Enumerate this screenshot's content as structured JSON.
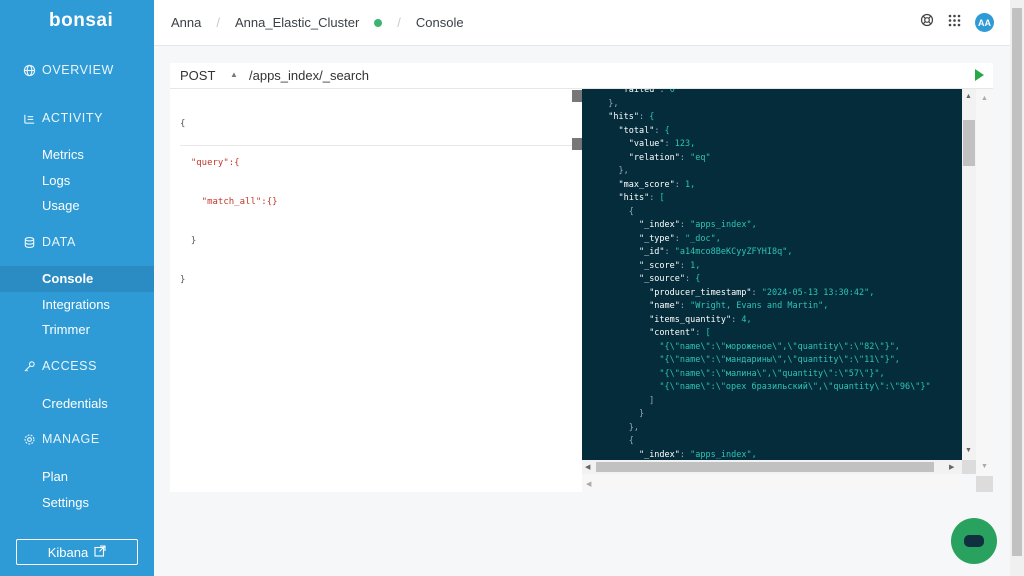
{
  "sidebar": {
    "logo": "bonsai",
    "sections": {
      "overview": "OVERVIEW",
      "activity": "ACTIVITY",
      "data": "DATA",
      "access": "ACCESS",
      "manage": "MANAGE"
    },
    "items": {
      "metrics": "Metrics",
      "logs": "Logs",
      "usage": "Usage",
      "console": "Console",
      "integrations": "Integrations",
      "trimmer": "Trimmer",
      "credentials": "Credentials",
      "plan": "Plan",
      "settings": "Settings"
    },
    "kibana": "Kibana"
  },
  "header": {
    "user": "Anna",
    "cluster": "Anna_Elastic_Cluster",
    "page": "Console",
    "avatar": "AA",
    "status_color": "#3cb371"
  },
  "console": {
    "method": "POST",
    "path": "/apps_index/_search",
    "request_lines": [
      "{",
      "  \"query\":{",
      "    \"match_all\":{}",
      "  }",
      "}"
    ],
    "response_lines": [
      "    \"failed\": 0",
      "  },",
      "  \"hits\": {",
      "    \"total\": {",
      "      \"value\": 123,",
      "      \"relation\": \"eq\"",
      "    },",
      "    \"max_score\": 1,",
      "    \"hits\": [",
      "      {",
      "        \"_index\": \"apps_index\",",
      "        \"_type\": \"_doc\",",
      "        \"_id\": \"a14mco8BeKCyyZFYHI8q\",",
      "        \"_score\": 1,",
      "        \"_source\": {",
      "          \"producer_timestamp\": \"2024-05-13 13:30:42\",",
      "          \"name\": \"Wright, Evans and Martin\",",
      "          \"items_quantity\": 4,",
      "          \"content\": [",
      "            \"{\\\"name\\\":\\\"мороженое\\\",\\\"quantity\\\":\\\"82\\\"}\",",
      "            \"{\\\"name\\\":\\\"мандарины\\\",\\\"quantity\\\":\\\"11\\\"}\",",
      "            \"{\\\"name\\\":\\\"малина\\\",\\\"quantity\\\":\\\"57\\\"}\",",
      "            \"{\\\"name\\\":\\\"орех бразильский\\\",\\\"quantity\\\":\\\"96\\\"}\"",
      "          ]",
      "        }",
      "      },",
      "      {",
      "        \"_index\": \"apps_index\","
    ]
  },
  "icons": {
    "overview": "globe-icon",
    "activity": "list-icon",
    "data": "database-icon",
    "access": "key-icon",
    "manage": "gear-icon",
    "help": "lifebuoy-icon",
    "apps": "grid-icon",
    "chat": "chat-icon",
    "external": "external-link-icon"
  }
}
